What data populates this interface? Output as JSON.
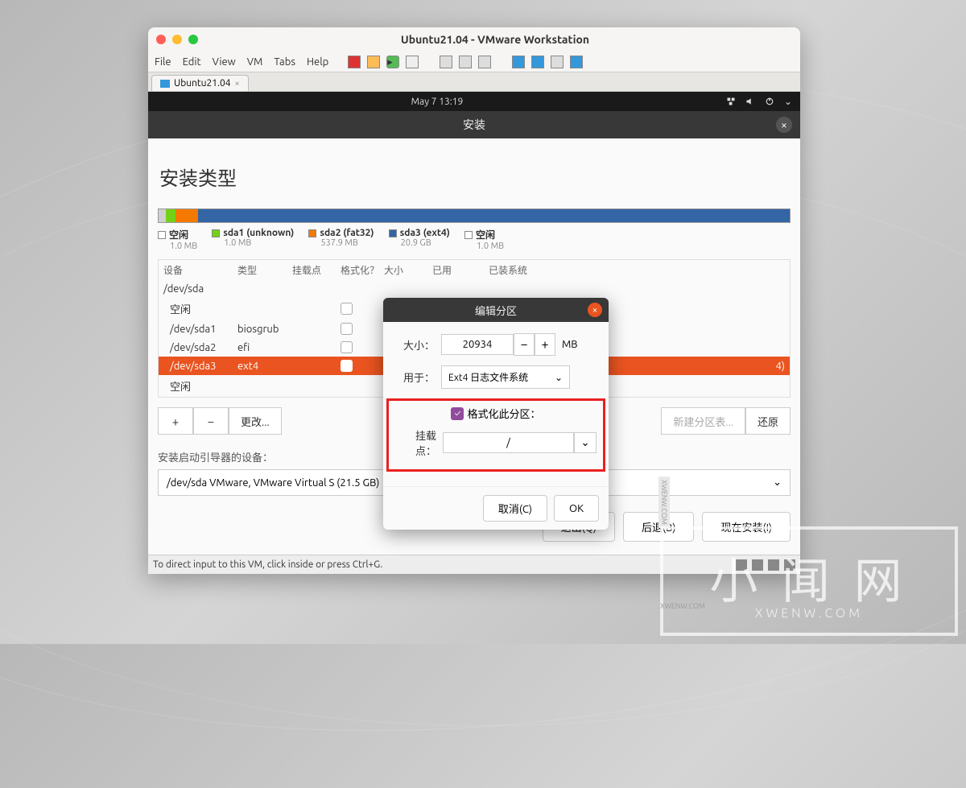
{
  "window": {
    "title": "Ubuntu21.04 - VMware Workstation"
  },
  "menu": {
    "file": "File",
    "edit": "Edit",
    "view": "View",
    "vm": "VM",
    "tabs": "Tabs",
    "help": "Help"
  },
  "tab": {
    "label": "Ubuntu21.04"
  },
  "topbar": {
    "datetime": "May 7  13:19"
  },
  "installer": {
    "bar_title": "安装",
    "heading": "安装类型",
    "legend": [
      {
        "name": "空闲",
        "size": "1.0 MB",
        "color": "#fff"
      },
      {
        "name": "sda1 (unknown)",
        "size": "1.0 MB",
        "color": "#73d216"
      },
      {
        "name": "sda2 (fat32)",
        "size": "537.9 MB",
        "color": "#f57900"
      },
      {
        "name": "sda3 (ext4)",
        "size": "20.9 GB",
        "color": "#3465a4"
      },
      {
        "name": "空闲",
        "size": "1.0 MB",
        "color": "#fff"
      }
    ],
    "columns": {
      "device": "设备",
      "type": "类型",
      "mount": "挂载点",
      "format": "格式化？",
      "size": "大小",
      "used": "已用",
      "system": "已装系统"
    },
    "rows": [
      {
        "device": "/dev/sda",
        "type": "",
        "format": false
      },
      {
        "device": "空闲",
        "type": "",
        "format": false
      },
      {
        "device": "/dev/sda1",
        "type": "biosgrub",
        "format": false
      },
      {
        "device": "/dev/sda2",
        "type": "efi",
        "format": false
      },
      {
        "device": "/dev/sda3",
        "type": "ext4",
        "format": false,
        "selected": true,
        "extra": "4)"
      },
      {
        "device": "空闲",
        "type": "",
        "format": false
      }
    ],
    "btn_plus": "+",
    "btn_minus": "−",
    "btn_change": "更改...",
    "btn_newtable": "新建分区表...",
    "btn_revert": "还原",
    "boot_label": "安装启动引导器的设备：",
    "boot_device": "/dev/sda   VMware, VMware Virtual S (21.5 GB)",
    "btn_quit": "退出(Q)",
    "btn_back": "后退(B)",
    "btn_install": "现在安装(I)"
  },
  "modal": {
    "title": "编辑分区",
    "size_label": "大小：",
    "size_value": "20934",
    "size_unit": "MB",
    "use_label": "用于：",
    "use_value": "Ext4 日志文件系统",
    "format_label": "格式化此分区：",
    "mount_label": "挂载点：",
    "mount_value": "/",
    "cancel": "取消(C)",
    "ok": "OK"
  },
  "status": {
    "text": "To direct input to this VM, click inside or press Ctrl+G."
  },
  "watermark": {
    "main": "小 闻 网",
    "sub": "XWENW.COM",
    "tag": "XWENW.COM",
    "bottom": "XWENW.COM"
  }
}
